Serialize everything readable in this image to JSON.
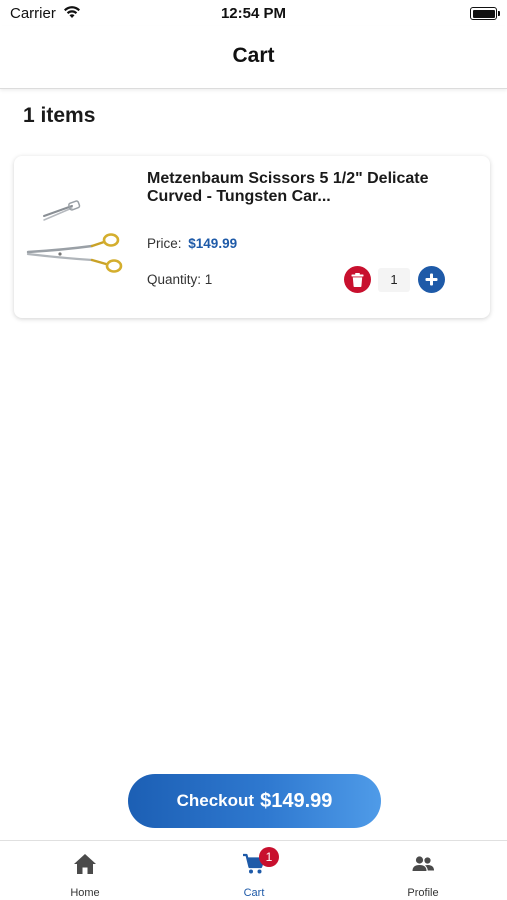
{
  "status_bar": {
    "carrier": "Carrier",
    "time": "12:54 PM",
    "wifi_icon": "wifi-icon",
    "battery_icon": "battery-icon"
  },
  "header": {
    "title": "Cart"
  },
  "cart": {
    "items_count_label": "1 items",
    "items": [
      {
        "name": "Metzenbaum Scissors 5 1/2\" Delicate Curved - Tungsten Car...",
        "price_label": "Price:",
        "price": "$149.99",
        "quantity_label": "Quantity: 1",
        "quantity_value": "1",
        "image_icon": "scissors-product-image",
        "delete_icon": "trash-icon",
        "add_icon": "plus-icon"
      }
    ]
  },
  "checkout": {
    "label": "Checkout",
    "total": "$149.99"
  },
  "tab_bar": {
    "tabs": [
      {
        "label": "Home",
        "icon": "home-icon",
        "active": false
      },
      {
        "label": "Cart",
        "icon": "cart-icon",
        "active": true,
        "badge": "1"
      },
      {
        "label": "Profile",
        "icon": "profile-icon",
        "active": false
      }
    ]
  },
  "colors": {
    "accent_blue": "#1e5aa8",
    "danger_red": "#c8102e",
    "checkout_gradient_start": "#1c5fb4",
    "checkout_gradient_end": "#4f9be8"
  }
}
